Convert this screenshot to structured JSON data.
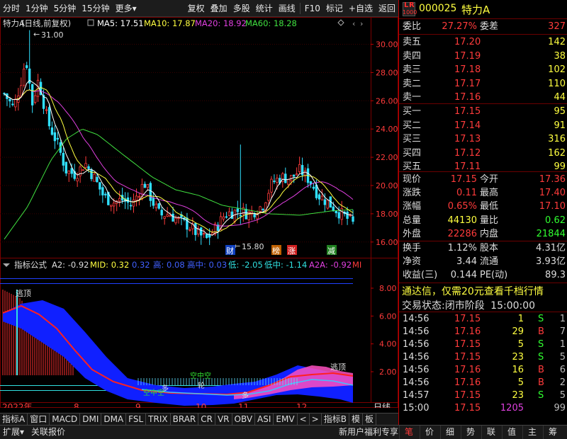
{
  "toolbar": {
    "left": [
      "分时",
      "1分钟",
      "5分钟",
      "15分钟",
      "更多"
    ],
    "right": [
      "复权",
      "叠加",
      "多股",
      "统计",
      "画线",
      "F10",
      "标记",
      "+自选",
      "返回"
    ]
  },
  "kline": {
    "title": "特力A",
    "adjust": "(日线,前复权)",
    "ma5": "MA5: 17.51",
    "ma10": "MA10: 17.87",
    "ma20": "MA20: 18.92",
    "ma60": "MA60: 18.28",
    "high_label": "31.00",
    "low_label": "15.80",
    "y_ticks": [
      "30.00",
      "28.00",
      "26.00",
      "24.00",
      "22.00",
      "20.00",
      "18.00",
      "16.00"
    ],
    "markers": [
      "财",
      "榜",
      "涨",
      "减"
    ],
    "colors": {
      "up": "#ff3b3b",
      "down": "#30e0ff",
      "ma5": "#ffffff",
      "ma10": "#ffff40",
      "ma20": "#e040e0",
      "ma60": "#40e040"
    }
  },
  "indicator": {
    "name": "指标公式",
    "a2": "A2: -0.92",
    "mid": "MID: 0.32",
    "v1": "0.32",
    "gao": "高: 0.08",
    "gaozhong": "高中: 0.03",
    "di": "低: -2.05",
    "dizhong": "低中: -1.14",
    "a2a": "A2A: -0.92",
    "tail": "MI",
    "y_ticks": [
      "8.00",
      "6.00",
      "4.00",
      "2.00"
    ],
    "labels": {
      "tao1": "逃顶",
      "tao2": "逃顶",
      "duo1": "多",
      "duo2": "多",
      "kong1": "空中空",
      "kong2": "空中空",
      "lun": "轮"
    }
  },
  "xaxis": {
    "year": "2022年",
    "m8": "8",
    "m9": "9",
    "m10": "10",
    "m11": "11",
    "m12": "12",
    "period": "日线"
  },
  "tabs": [
    "指标A",
    "窗口",
    "MACD",
    "DMI",
    "DMA",
    "FSL",
    "TRIX",
    "BRAR",
    "CR",
    "VR",
    "OBV",
    "ASI",
    "EMV",
    "<",
    ">",
    "指标B",
    "模",
    "板"
  ],
  "status": {
    "left1": "扩展",
    "left2": "关联报价",
    "promo": "新用户福利专享",
    "qtabs": [
      "笔",
      "价",
      "细",
      "势",
      "联",
      "值",
      "主",
      "筹"
    ]
  },
  "quote": {
    "code": "000025",
    "name": "特力A",
    "logo_l": "L",
    "logo_r": "R",
    "logo_num": "1000",
    "weibi_label": "委比",
    "weibi": "27.27%",
    "weicha_label": "委差",
    "weicha": "327",
    "asks": [
      {
        "label": "卖五",
        "price": "17.20",
        "vol": "142"
      },
      {
        "label": "卖四",
        "price": "17.19",
        "vol": "38"
      },
      {
        "label": "卖三",
        "price": "17.18",
        "vol": "102"
      },
      {
        "label": "卖二",
        "price": "17.17",
        "vol": "110"
      },
      {
        "label": "卖一",
        "price": "17.16",
        "vol": "44"
      }
    ],
    "bids": [
      {
        "label": "买一",
        "price": "17.15",
        "vol": "95"
      },
      {
        "label": "买二",
        "price": "17.14",
        "vol": "91"
      },
      {
        "label": "买三",
        "price": "17.13",
        "vol": "316"
      },
      {
        "label": "买四",
        "price": "17.12",
        "vol": "162"
      },
      {
        "label": "买五",
        "price": "17.11",
        "vol": "99"
      }
    ],
    "stats": [
      {
        "l1": "现价",
        "v1": "17.15",
        "c1": "red",
        "l2": "今开",
        "v2": "17.36",
        "c2": "red"
      },
      {
        "l1": "涨跌",
        "v1": "0.11",
        "c1": "red",
        "l2": "最高",
        "v2": "17.40",
        "c2": "red"
      },
      {
        "l1": "涨幅",
        "v1": "0.65%",
        "c1": "red",
        "l2": "最低",
        "v2": "17.10",
        "c2": "red"
      },
      {
        "l1": "总量",
        "v1": "44130",
        "c1": "yellow",
        "l2": "量比",
        "v2": "0.62",
        "c2": "green"
      },
      {
        "l1": "外盘",
        "v1": "22286",
        "c1": "red",
        "l2": "内盘",
        "v2": "21844",
        "c2": "green"
      }
    ],
    "fund": [
      {
        "l1": "换手",
        "v1": "1.12%",
        "l2": "股本",
        "v2": "4.31亿"
      },
      {
        "l1": "净资",
        "v1": "3.44",
        "l2": "流通",
        "v2": "3.93亿"
      },
      {
        "l1": "收益(三)",
        "v1": "0.144",
        "l2": "PE(动)",
        "v2": "89.3"
      }
    ],
    "banner": "通达信，仅需20元查看千档行情",
    "trade_state_label": "交易状态:",
    "trade_state": "闭市阶段",
    "trade_time": "15:00:00",
    "ticks": [
      {
        "t": "14:56",
        "p": "17.15",
        "v": "1",
        "bs": "S",
        "n": "1",
        "pc": "red",
        "vc": "yellow",
        "bc": "green"
      },
      {
        "t": "14:56",
        "p": "17.16",
        "v": "29",
        "bs": "B",
        "n": "7",
        "pc": "red",
        "vc": "yellow",
        "bc": "red"
      },
      {
        "t": "14:56",
        "p": "17.15",
        "v": "5",
        "bs": "S",
        "n": "1",
        "pc": "red",
        "vc": "yellow",
        "bc": "green"
      },
      {
        "t": "14:56",
        "p": "17.15",
        "v": "23",
        "bs": "S",
        "n": "5",
        "pc": "red",
        "vc": "yellow",
        "bc": "green"
      },
      {
        "t": "14:56",
        "p": "17.16",
        "v": "16",
        "bs": "B",
        "n": "6",
        "pc": "red",
        "vc": "yellow",
        "bc": "red"
      },
      {
        "t": "14:56",
        "p": "17.16",
        "v": "5",
        "bs": "B",
        "n": "2",
        "pc": "red",
        "vc": "yellow",
        "bc": "red"
      },
      {
        "t": "14:57",
        "p": "17.15",
        "v": "23",
        "bs": "S",
        "n": "5",
        "pc": "red",
        "vc": "yellow",
        "bc": "green"
      },
      {
        "t": "15:00",
        "p": "17.15",
        "v": "1205",
        "bs": "",
        "n": "99",
        "pc": "red",
        "vc": "magenta",
        "bc": "white"
      }
    ]
  }
}
